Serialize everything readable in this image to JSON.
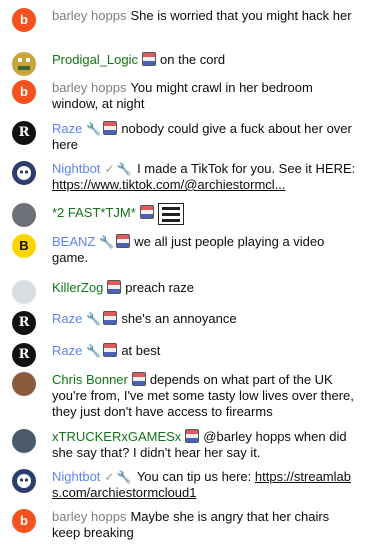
{
  "messages": [
    {
      "author": "barley hopps",
      "text": "She is worried that you might hack her",
      "avatar_letter": "b",
      "avatar": "letter-b"
    },
    {
      "author": "Prodigal_Logic",
      "text": "on the cord",
      "avatar": "pixel-art"
    },
    {
      "author": "barley hopps",
      "text": "You might crawl in her bedroom window, at night",
      "avatar_letter": "b",
      "avatar": "letter-b"
    },
    {
      "author": "Raze",
      "text": "nobody could give a fuck about her over here",
      "avatar_letter": "R",
      "avatar": "raze-logo"
    },
    {
      "author": "Nightbot",
      "text": "I made a TikTok for you. See it HERE:",
      "link": "https://www.tiktok.com/@archiestormcl...",
      "avatar": "nightbot-logo"
    },
    {
      "author": "*2 FAST*TJM*",
      "text": "",
      "avatar": "photo"
    },
    {
      "author": "BEANZ",
      "text": "we all just people playing a video game.",
      "avatar_letter": "B",
      "avatar": "beanz-logo"
    },
    {
      "author": "KillerZog",
      "text": "preach raze",
      "avatar": "photo"
    },
    {
      "author": "Raze",
      "text": "she's an annoyance",
      "avatar_letter": "R",
      "avatar": "raze-logo"
    },
    {
      "author": "Raze",
      "text": "at best",
      "avatar_letter": "R",
      "avatar": "raze-logo"
    },
    {
      "author": "Chris Bonner",
      "text": "depends on what part of the UK you're from, I've met some tasty low lives over there, they just don't have access to firearms",
      "avatar": "photo"
    },
    {
      "author": "xTRUCKERxGAMESx",
      "text": "@barley hopps when did she say that? I didn't hear her say it.",
      "avatar": "photo"
    },
    {
      "author": "Nightbot",
      "text": "You can tip us here:",
      "link": "https://streamlabs.com/archiestormcloud1",
      "avatar": "nightbot-logo"
    },
    {
      "author": "barley hopps",
      "text": "Maybe she is angry that her chairs keep breaking",
      "avatar_letter": "b",
      "avatar": "letter-b"
    }
  ],
  "colors": {
    "moderator": "#5e84f1",
    "member": "#107516",
    "default": "#808080",
    "avatar_orange": "#f4511e"
  }
}
